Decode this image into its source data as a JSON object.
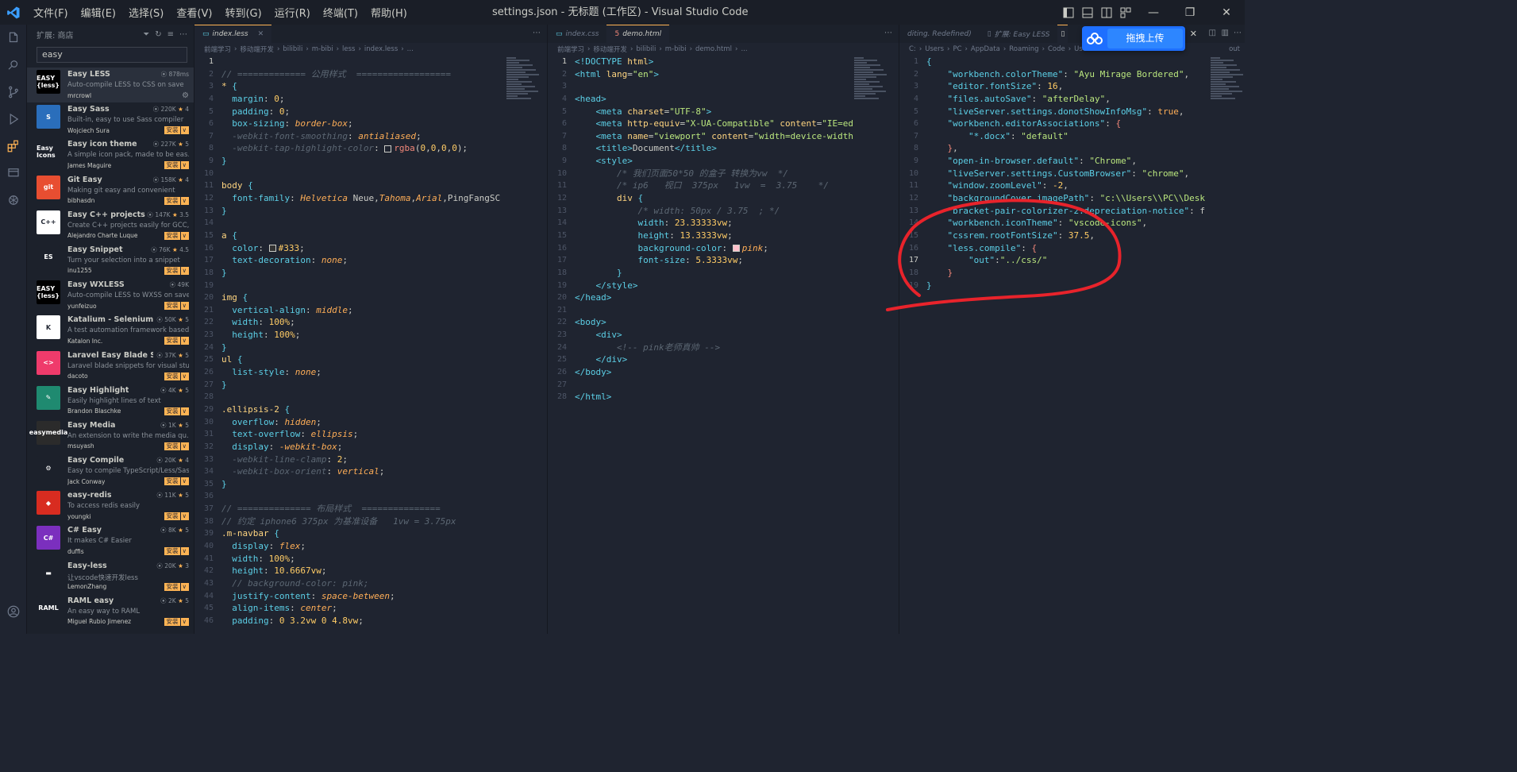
{
  "window": {
    "title": "settings.json - 无标题 (工作区) - Visual Studio Code",
    "menus": [
      "文件(F)",
      "编辑(E)",
      "选择(S)",
      "查看(V)",
      "转到(G)",
      "运行(R)",
      "终端(T)",
      "帮助(H)"
    ]
  },
  "sidebar": {
    "header": "扩展: 商店",
    "search_value": "easy",
    "install_label": "安装",
    "extensions": [
      {
        "name": "Easy LESS",
        "meta": "878ms",
        "desc": "Auto-compile LESS to CSS on save",
        "publisher": "mrcrowl",
        "installed": true,
        "icon_text": "EASY {less}",
        "icon_bg": "#000000"
      },
      {
        "name": "Easy Sass",
        "meta": "220K",
        "rating": "4",
        "desc": "Built-in, easy to use Sass compiler",
        "publisher": "Wojciech Sura",
        "icon_text": "S",
        "icon_bg": "#2a6ebb"
      },
      {
        "name": "Easy icon theme",
        "meta": "227K",
        "rating": "5",
        "desc": "A simple icon pack, made to be eas...",
        "publisher": "James Maguire",
        "icon_text": "Easy Icons",
        "icon_bg": "#1c212b"
      },
      {
        "name": "Git Easy",
        "meta": "158K",
        "rating": "4",
        "desc": "Making git easy and convenient",
        "publisher": "bibhasdn",
        "icon_text": "git",
        "icon_bg": "#e84e31"
      },
      {
        "name": "Easy C++ projects",
        "meta": "147K",
        "rating": "3.5",
        "desc": "Create C++ projects easily for GCC, ...",
        "publisher": "Alejandro Charte Luque",
        "icon_text": "C++",
        "icon_bg": "#ffffff"
      },
      {
        "name": "Easy Snippet",
        "meta": "76K",
        "rating": "4.5",
        "desc": "Turn your selection into a snippet",
        "publisher": "inu1255",
        "icon_text": "ES",
        "icon_bg": "#1c212b"
      },
      {
        "name": "Easy WXLESS",
        "meta": "49K",
        "desc": "Auto-compile LESS to WXSS on save",
        "publisher": "yunfeizuo",
        "icon_text": "EASY {less}",
        "icon_bg": "#000000"
      },
      {
        "name": "Katalium - Selenium a...",
        "meta": "50K",
        "rating": "5",
        "desc": "A test automation framework based...",
        "publisher": "Katalon Inc.",
        "icon_text": "K",
        "icon_bg": "#ffffff"
      },
      {
        "name": "Laravel Easy Blade Sni...",
        "meta": "37K",
        "rating": "5",
        "desc": "Laravel blade snippets for visual stu...",
        "publisher": "dacoto",
        "icon_text": "<>",
        "icon_bg": "#ef3b6b"
      },
      {
        "name": "Easy Highlight",
        "meta": "4K",
        "rating": "5",
        "desc": "Easily highlight lines of text",
        "publisher": "Brandon Blaschke",
        "icon_text": "✎",
        "icon_bg": "#1f8a70"
      },
      {
        "name": "Easy Media",
        "meta": "1K",
        "rating": "5",
        "desc": "An extension to write the media qu...",
        "publisher": "msuyash",
        "icon_text": "easymedia",
        "icon_bg": "#2b2b2b"
      },
      {
        "name": "Easy Compile",
        "meta": "20K",
        "rating": "4",
        "desc": "Easy to compile TypeScript/Less/Sas...",
        "publisher": "Jack Conway",
        "icon_text": "⚙",
        "icon_bg": "#1c212b"
      },
      {
        "name": "easy-redis",
        "meta": "11K",
        "rating": "5",
        "desc": "To access redis easily",
        "publisher": "youngki",
        "icon_text": "◆",
        "icon_bg": "#d82c20"
      },
      {
        "name": "C# Easy",
        "meta": "8K",
        "rating": "5",
        "desc": "It makes C# Easier",
        "publisher": "duffis",
        "icon_text": "C#",
        "icon_bg": "#7b2fbe"
      },
      {
        "name": "Easy-less",
        "meta": "20K",
        "rating": "3",
        "desc": "让vscode快速开发less",
        "publisher": "LemonZhang",
        "icon_text": "▬",
        "icon_bg": "#1c212b"
      },
      {
        "name": "RAML easy",
        "meta": "2K",
        "rating": "5",
        "desc": "An easy way to RAML",
        "publisher": "Miguel Rubio Jimenez",
        "icon_text": "RAML",
        "icon_bg": "#1c212b"
      }
    ]
  },
  "editor1": {
    "tab": "index.less",
    "crumbs": [
      "前端学习",
      "移动端开发",
      "bilibili",
      "m-bibi",
      "less",
      "index.less",
      "..."
    ]
  },
  "editor2": {
    "tabs": [
      "index.css",
      "demo.html"
    ],
    "crumbs": [
      "前端学习",
      "移动端开发",
      "bilibili",
      "m-bibi",
      "demo.html",
      "..."
    ]
  },
  "editor3": {
    "tabs": [
      "diting. Redefined)",
      "扩展: Easy LESS"
    ],
    "crumbs": [
      "C:",
      "Users",
      "PC",
      "AppData",
      "Roaming",
      "Code",
      "User"
    ],
    "crumbs_tail": "out"
  },
  "cloud": {
    "label": "拖拽上传"
  }
}
